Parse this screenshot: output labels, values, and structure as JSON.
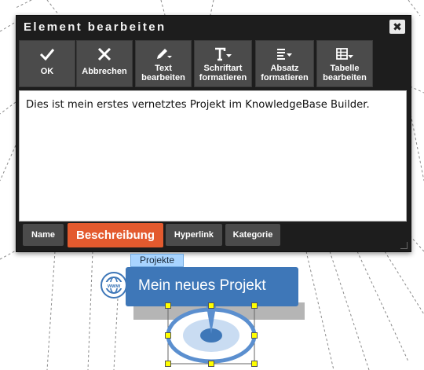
{
  "dialog": {
    "title": "Element bearbeiten",
    "close_symbol": "✖"
  },
  "toolbar": {
    "ok": {
      "label": "OK",
      "icon": "check-icon"
    },
    "cancel": {
      "label": "Abbrechen",
      "icon": "close-x-icon"
    },
    "edit_text": {
      "line1": "Text",
      "line2": "bearbeiten",
      "icon": "pencil-dropdown-icon"
    },
    "format_font": {
      "line1": "Schriftart",
      "line2": "formatieren",
      "icon": "font-dropdown-icon"
    },
    "format_paragraph": {
      "line1": "Absatz",
      "line2": "formatieren",
      "icon": "paragraph-dropdown-icon"
    },
    "edit_table": {
      "line1": "Tabelle",
      "line2": "bearbeiten",
      "icon": "table-dropdown-icon"
    }
  },
  "editor": {
    "content": "Dies ist mein erstes vernetztes Projekt im KnowledgeBase Builder."
  },
  "tabs": {
    "name": "Name",
    "description": "Beschreibung",
    "hyperlink": "Hyperlink",
    "category": "Kategorie"
  },
  "node": {
    "category_label": "Projekte",
    "title": "Mein neues Projekt",
    "icon": "www-globe-icon",
    "icon_text": "www"
  },
  "colors": {
    "dialog_bg": "#1d1d1d",
    "button_bg": "#4b4b4b",
    "active_tab": "#e35a2e",
    "node_blue": "#3e77b8",
    "category_label_bg": "#a8d4ff",
    "handle_yellow": "#ffff00"
  }
}
